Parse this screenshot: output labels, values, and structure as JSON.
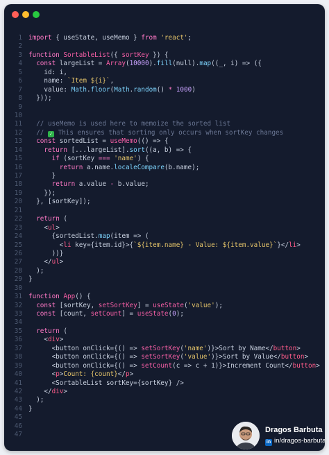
{
  "window": {
    "controls": [
      "close",
      "minimize",
      "maximize"
    ],
    "colors": {
      "close": "#ff5f57",
      "minimize": "#febc2e",
      "maximize": "#28c840"
    }
  },
  "code": {
    "lines": [
      {
        "n": "1",
        "tokens": [
          [
            "kw",
            "import"
          ],
          [
            "pun",
            " { useState, useMemo } "
          ],
          [
            "kw",
            "from"
          ],
          [
            "pun",
            " "
          ],
          [
            "str",
            "'react'"
          ],
          [
            "pun",
            ";"
          ]
        ]
      },
      {
        "n": "2",
        "tokens": []
      },
      {
        "n": "3",
        "tokens": [
          [
            "kw",
            "function"
          ],
          [
            "pun",
            " "
          ],
          [
            "fn",
            "SortableList"
          ],
          [
            "pun",
            "({ "
          ],
          [
            "fn",
            "sortKey"
          ],
          [
            "pun",
            " }) {"
          ]
        ]
      },
      {
        "n": "4",
        "tokens": [
          [
            "pun",
            "  "
          ],
          [
            "kw",
            "const"
          ],
          [
            "pun",
            " largeList = "
          ],
          [
            "fn",
            "Array"
          ],
          [
            "pun",
            "("
          ],
          [
            "num",
            "10000"
          ],
          [
            "pun",
            ")."
          ],
          [
            "prop",
            "fill"
          ],
          [
            "pun",
            "(null)."
          ],
          [
            "prop",
            "map"
          ],
          [
            "pun",
            "((_, i) => ({"
          ]
        ]
      },
      {
        "n": "5",
        "tokens": [
          [
            "pun",
            "    id: i,"
          ]
        ]
      },
      {
        "n": "6",
        "tokens": [
          [
            "pun",
            "    name: "
          ],
          [
            "str",
            "`Item ${i}`"
          ],
          [
            "pun",
            ","
          ]
        ]
      },
      {
        "n": "7",
        "tokens": [
          [
            "pun",
            "    value: "
          ],
          [
            "prop",
            "Math"
          ],
          [
            "pun",
            "."
          ],
          [
            "prop",
            "floor"
          ],
          [
            "pun",
            "("
          ],
          [
            "prop",
            "Math"
          ],
          [
            "pun",
            "."
          ],
          [
            "prop",
            "random"
          ],
          [
            "pun",
            "() "
          ],
          [
            "op",
            "*"
          ],
          [
            "pun",
            " "
          ],
          [
            "num",
            "1000"
          ],
          [
            "pun",
            ")"
          ]
        ]
      },
      {
        "n": "8",
        "tokens": [
          [
            "pun",
            "  }));"
          ]
        ]
      },
      {
        "n": "9",
        "tokens": []
      },
      {
        "n": "10",
        "tokens": []
      },
      {
        "n": "11",
        "tokens": [
          [
            "cmt",
            "  // useMemo is used here to memoize the sorted list"
          ]
        ]
      },
      {
        "n": "12",
        "tokens": [
          [
            "cmt",
            "  // "
          ],
          [
            "emoji",
            "✓"
          ],
          [
            "cmt",
            " This ensures that sorting only occurs when sortKey changes"
          ]
        ]
      },
      {
        "n": "13",
        "tokens": [
          [
            "pun",
            "  "
          ],
          [
            "kw",
            "const"
          ],
          [
            "pun",
            " sortedList = "
          ],
          [
            "fn",
            "useMemo"
          ],
          [
            "pun",
            "(() => {"
          ]
        ]
      },
      {
        "n": "14",
        "tokens": [
          [
            "pun",
            "    "
          ],
          [
            "kw",
            "return"
          ],
          [
            "pun",
            " [...largeList]."
          ],
          [
            "prop",
            "sort"
          ],
          [
            "pun",
            "((a, b) => {"
          ]
        ]
      },
      {
        "n": "15",
        "tokens": [
          [
            "pun",
            "      "
          ],
          [
            "kw",
            "if"
          ],
          [
            "pun",
            " (sortKey "
          ],
          [
            "op",
            "==="
          ],
          [
            "pun",
            " "
          ],
          [
            "str",
            "'name'"
          ],
          [
            "pun",
            ") {"
          ]
        ]
      },
      {
        "n": "16",
        "tokens": [
          [
            "pun",
            "        "
          ],
          [
            "kw",
            "return"
          ],
          [
            "pun",
            " a.name."
          ],
          [
            "prop",
            "localeCompare"
          ],
          [
            "pun",
            "(b.name);"
          ]
        ]
      },
      {
        "n": "17",
        "tokens": [
          [
            "pun",
            "      }"
          ]
        ]
      },
      {
        "n": "18",
        "tokens": [
          [
            "pun",
            "      "
          ],
          [
            "kw",
            "return"
          ],
          [
            "pun",
            " a.value "
          ],
          [
            "op",
            "-"
          ],
          [
            "pun",
            " b.value;"
          ]
        ]
      },
      {
        "n": "19",
        "tokens": [
          [
            "pun",
            "    });"
          ]
        ]
      },
      {
        "n": "20",
        "tokens": [
          [
            "pun",
            "  }, [sortKey]);"
          ]
        ]
      },
      {
        "n": "21",
        "tokens": []
      },
      {
        "n": "22",
        "tokens": [
          [
            "pun",
            "  "
          ],
          [
            "kw",
            "return"
          ],
          [
            "pun",
            " ("
          ]
        ]
      },
      {
        "n": "23",
        "tokens": [
          [
            "pun",
            "    <"
          ],
          [
            "tag",
            "ul"
          ],
          [
            "pun",
            ">"
          ]
        ]
      },
      {
        "n": "24",
        "tokens": [
          [
            "pun",
            "      {sortedList."
          ],
          [
            "prop",
            "map"
          ],
          [
            "pun",
            "(item => ("
          ]
        ]
      },
      {
        "n": "25",
        "tokens": [
          [
            "pun",
            "        <"
          ],
          [
            "tag",
            "li"
          ],
          [
            "pun",
            " key={item.id}>{"
          ],
          [
            "str",
            "`${item.name} - Value: ${item.value}`"
          ],
          [
            "pun",
            "}</"
          ],
          [
            "tag",
            "li"
          ],
          [
            "pun",
            ">"
          ]
        ]
      },
      {
        "n": "26",
        "tokens": [
          [
            "pun",
            "      ))}"
          ]
        ]
      },
      {
        "n": "27",
        "tokens": [
          [
            "pun",
            "    </"
          ],
          [
            "tag",
            "ul"
          ],
          [
            "pun",
            ">"
          ]
        ]
      },
      {
        "n": "28",
        "tokens": [
          [
            "pun",
            "  );"
          ]
        ]
      },
      {
        "n": "29",
        "tokens": [
          [
            "pun",
            "}"
          ]
        ]
      },
      {
        "n": "30",
        "tokens": []
      },
      {
        "n": "31",
        "tokens": [
          [
            "kw",
            "function"
          ],
          [
            "pun",
            " "
          ],
          [
            "fn",
            "App"
          ],
          [
            "pun",
            "() {"
          ]
        ]
      },
      {
        "n": "32",
        "tokens": [
          [
            "pun",
            "  "
          ],
          [
            "kw",
            "const"
          ],
          [
            "pun",
            " [sortKey, "
          ],
          [
            "fn",
            "setSortKey"
          ],
          [
            "pun",
            "] = "
          ],
          [
            "fn",
            "useState"
          ],
          [
            "pun",
            "("
          ],
          [
            "str",
            "'value'"
          ],
          [
            "pun",
            ");"
          ]
        ]
      },
      {
        "n": "33",
        "tokens": [
          [
            "pun",
            "  "
          ],
          [
            "kw",
            "const"
          ],
          [
            "pun",
            " [count, "
          ],
          [
            "fn",
            "setCount"
          ],
          [
            "pun",
            "] = "
          ],
          [
            "fn",
            "useState"
          ],
          [
            "pun",
            "("
          ],
          [
            "num",
            "0"
          ],
          [
            "pun",
            ");"
          ]
        ]
      },
      {
        "n": "34",
        "tokens": []
      },
      {
        "n": "35",
        "tokens": [
          [
            "pun",
            "  "
          ],
          [
            "kw",
            "return"
          ],
          [
            "pun",
            " ("
          ]
        ]
      },
      {
        "n": "36",
        "tokens": [
          [
            "pun",
            "    <"
          ],
          [
            "tag",
            "div"
          ],
          [
            "pun",
            ">"
          ]
        ]
      },
      {
        "n": "37",
        "tokens": [
          [
            "pun",
            "      <button onClick={() => "
          ],
          [
            "fn",
            "setSortKey"
          ],
          [
            "pun",
            "("
          ],
          [
            "str",
            "'name'"
          ],
          [
            "pun",
            ")}>Sort by Name</"
          ],
          [
            "tag",
            "button"
          ],
          [
            "pun",
            ">"
          ]
        ]
      },
      {
        "n": "38",
        "tokens": [
          [
            "pun",
            "      <button onClick={() => "
          ],
          [
            "fn",
            "setSortKey"
          ],
          [
            "pun",
            "("
          ],
          [
            "str",
            "'value'"
          ],
          [
            "pun",
            ")}>Sort by Value</"
          ],
          [
            "tag",
            "button"
          ],
          [
            "pun",
            ">"
          ]
        ]
      },
      {
        "n": "39",
        "tokens": [
          [
            "pun",
            "      <button onClick={() => "
          ],
          [
            "fn",
            "setCount"
          ],
          [
            "pun",
            "(c => c + 1)}>Increment Count</"
          ],
          [
            "tag",
            "button"
          ],
          [
            "pun",
            ">"
          ]
        ]
      },
      {
        "n": "40",
        "tokens": [
          [
            "pun",
            "      <"
          ],
          [
            "tag",
            "p"
          ],
          [
            "pun",
            ">"
          ],
          [
            "str",
            "Count: {count}"
          ],
          [
            "pun",
            "</"
          ],
          [
            "tag",
            "p"
          ],
          [
            "pun",
            ">"
          ]
        ]
      },
      {
        "n": "41",
        "tokens": [
          [
            "pun",
            "      <SortableList sortKey={sortKey} />"
          ]
        ]
      },
      {
        "n": "42",
        "tokens": [
          [
            "pun",
            "    </"
          ],
          [
            "tag",
            "div"
          ],
          [
            "pun",
            ">"
          ]
        ]
      },
      {
        "n": "43",
        "tokens": [
          [
            "pun",
            "  );"
          ]
        ]
      },
      {
        "n": "44",
        "tokens": [
          [
            "pun",
            "}"
          ]
        ]
      },
      {
        "n": "45",
        "tokens": []
      },
      {
        "n": "46",
        "tokens": []
      },
      {
        "n": "47",
        "tokens": []
      }
    ]
  },
  "author": {
    "name": "Dragos Barbuta",
    "handle": "in/dragos-barbuta/",
    "handle_icon": "linkedin-icon",
    "avatar_icon": "avatar-photo"
  },
  "theme": {
    "background": "#141b2d",
    "keyword": "#ff79c6",
    "string": "#e6c56a",
    "comment": "#6b7794"
  }
}
